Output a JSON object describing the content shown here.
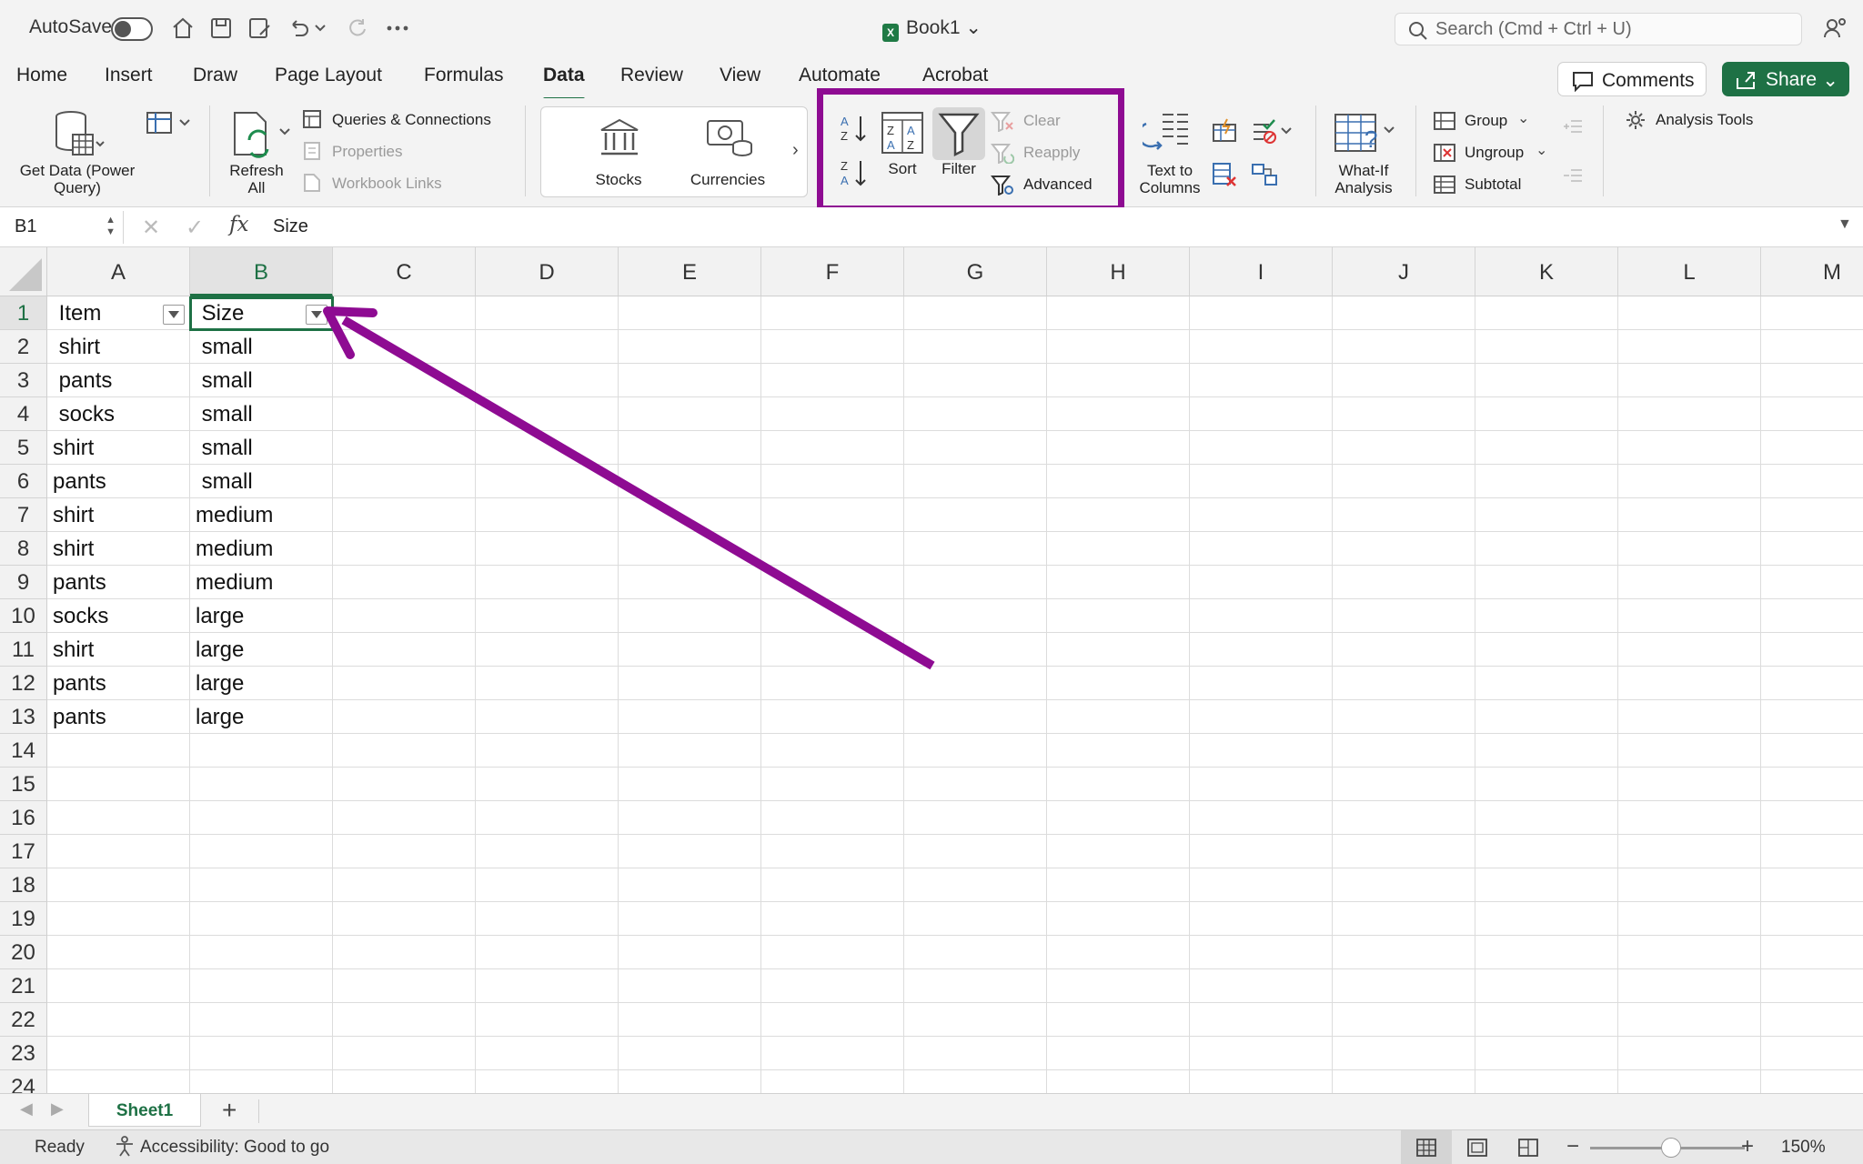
{
  "titlebar": {
    "autosave_label": "AutoSave",
    "title": "Book1",
    "search_placeholder": "Search (Cmd + Ctrl + U)"
  },
  "menu": {
    "tabs": [
      "Home",
      "Insert",
      "Draw",
      "Page Layout",
      "Formulas",
      "Data",
      "Review",
      "View",
      "Automate",
      "Acrobat"
    ],
    "active": "Data",
    "comments_label": "Comments",
    "share_label": "Share"
  },
  "ribbon": {
    "get_data": "Get Data (Power Query)",
    "refresh_all": "Refresh All",
    "queries": "Queries & Connections",
    "properties": "Properties",
    "workbook_links": "Workbook Links",
    "stocks": "Stocks",
    "currencies": "Currencies",
    "sort": "Sort",
    "filter": "Filter",
    "clear": "Clear",
    "reapply": "Reapply",
    "advanced": "Advanced",
    "text_to_columns": "Text to Columns",
    "what_if": "What-If Analysis",
    "group": "Group",
    "ungroup": "Ungroup",
    "subtotal": "Subtotal",
    "analysis_tools": "Analysis Tools",
    "highlight_color": "#8e0b92"
  },
  "formula_bar": {
    "name_box": "B1",
    "fx": "fx",
    "value": "Size"
  },
  "grid": {
    "columns": [
      "A",
      "B",
      "C",
      "D",
      "E",
      "F",
      "G",
      "H",
      "I",
      "J",
      "K",
      "L",
      "M"
    ],
    "rows": [
      "1",
      "2",
      "3",
      "4",
      "5",
      "6",
      "7",
      "8",
      "9",
      "10",
      "11",
      "12",
      "13",
      "14",
      "15",
      "16",
      "17",
      "18",
      "19",
      "20",
      "21",
      "22",
      "23",
      "24"
    ],
    "selected_column": "B",
    "selected_row": "1",
    "cells": [
      {
        "a": " Item",
        "b": " Size"
      },
      {
        "a": " shirt",
        "b": " small"
      },
      {
        "a": " pants",
        "b": " small"
      },
      {
        "a": " socks",
        "b": " small"
      },
      {
        "a": "shirt",
        "b": " small"
      },
      {
        "a": "pants",
        "b": " small"
      },
      {
        "a": "shirt",
        "b": "medium"
      },
      {
        "a": "shirt",
        "b": "medium"
      },
      {
        "a": "pants",
        "b": "medium"
      },
      {
        "a": "socks",
        "b": "large"
      },
      {
        "a": "shirt",
        "b": "large"
      },
      {
        "a": "pants",
        "b": "large"
      },
      {
        "a": "pants",
        "b": "large"
      }
    ],
    "annotation_arrow_color": "#8e0b92"
  },
  "sheets": {
    "tabs": [
      "Sheet1"
    ],
    "add_label": "+"
  },
  "status": {
    "ready": "Ready",
    "accessibility": "Accessibility: Good to go",
    "zoom": "150%"
  }
}
